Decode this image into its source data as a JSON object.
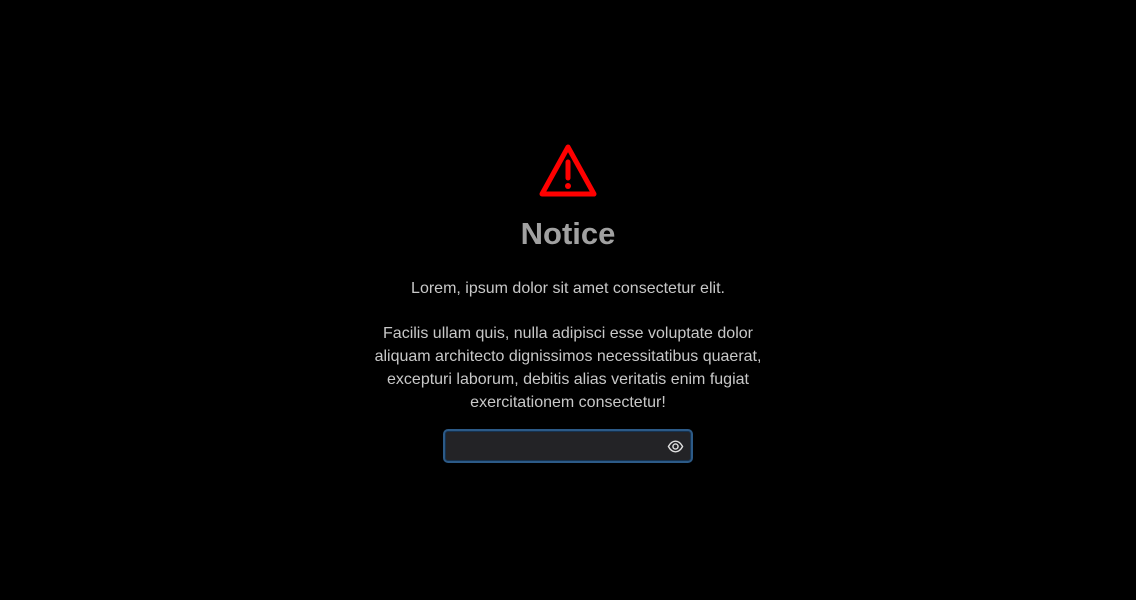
{
  "notice": {
    "icon": "warning-triangle-icon",
    "icon_color": "#ff0000",
    "title": "Notice",
    "lead": "Lorem, ipsum dolor sit amet consectetur elit.",
    "body": "Facilis ullam quis, nulla adipisci esse voluptate dolor aliquam architecto dignissimos necessitatibus quaerat, excepturi laborum, debitis alias veritatis enim fugiat exercitationem consectetur!"
  },
  "password": {
    "value": "",
    "placeholder": "",
    "toggle_icon": "eye-icon",
    "border_color": "#2c5a87",
    "field_color": "#232326"
  }
}
